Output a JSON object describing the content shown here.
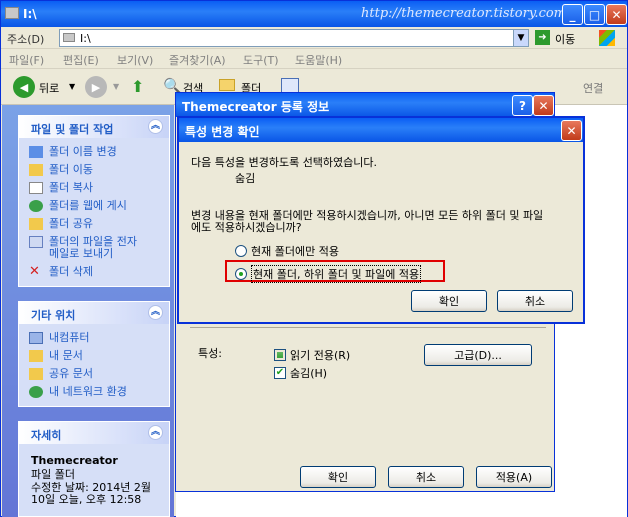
{
  "explorer": {
    "title": "I:\\",
    "watermark": "http://themecreator.tistory.com/",
    "address_label": "주소(D)",
    "address_value": "I:\\",
    "go_label": "이동",
    "menu": [
      "파일(F)",
      "편집(E)",
      "보기(V)",
      "즐겨찾기(A)",
      "도구(T)",
      "도움말(H)"
    ],
    "toolbar": {
      "back": "뒤로",
      "search": "검색",
      "folders": "폴더",
      "links": "연결"
    }
  },
  "left_pane": {
    "tasks": {
      "title": "파일 및 폴더 작업",
      "items": [
        "폴더 이름 변경",
        "폴더 이동",
        "폴더 복사",
        "폴더를 웹에 게시",
        "폴더 공유",
        "폴더의 파일을 전자\n메일로 보내기",
        "폴더 삭제"
      ]
    },
    "places": {
      "title": "기타 위치",
      "items": [
        "내컴퓨터",
        "내 문서",
        "공유 문서",
        "내 네트워크 환경"
      ]
    },
    "details": {
      "title": "자세히",
      "name": "Themecreator",
      "type": "파일 폴더",
      "modified": "수정한 날짜: 2014년 2월\n10일 오늘, 오후 12:58"
    }
  },
  "properties_dialog": {
    "title": "Themecreator 등록 정보",
    "attributes_label": "특성:",
    "readonly_label": "읽기 전용(R)",
    "hidden_label": "숨김(H)",
    "readonly_checked": true,
    "hidden_checked": true,
    "advanced_button": "고급(D)...",
    "ok": "확인",
    "cancel": "취소",
    "apply": "적용(A)"
  },
  "confirm_dialog": {
    "title": "특성 변경 확인",
    "message": "다음 특성을 변경하도록 선택하였습니다.",
    "attribute": "숨김",
    "question": "변경 내용을 현재 폴더에만 적용하시겠습니까, 아니면 모든 하위 폴더 및 파일\n에도 적용하시겠습니까?",
    "option1": "현재 폴더에만 적용",
    "option2": "현재 폴더, 하위 폴더 및 파일에 적용",
    "selected_option": 2,
    "ok": "확인",
    "cancel": "취소"
  },
  "colors": {
    "titlebar": "#0a5ef4",
    "highlight_box": "#e00000",
    "link": "#215dc6"
  }
}
